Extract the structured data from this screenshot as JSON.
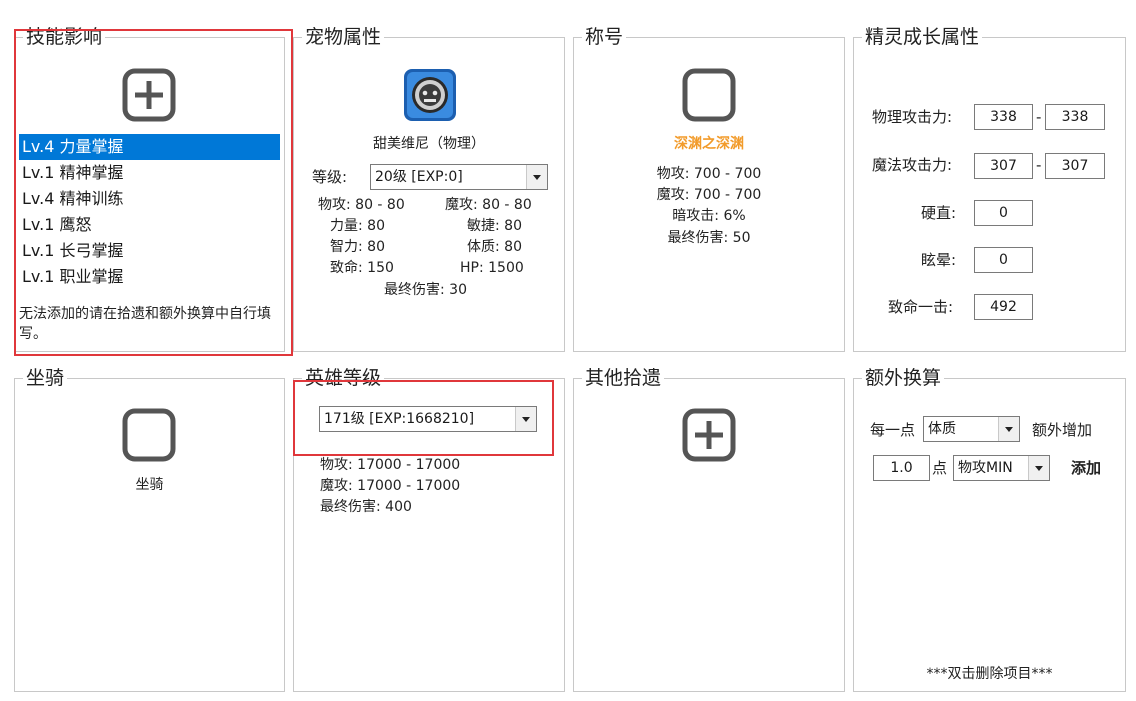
{
  "skills": {
    "title": "技能影响",
    "items": [
      {
        "label": "Lv.4 力量掌握"
      },
      {
        "label": "Lv.1 精神掌握"
      },
      {
        "label": "Lv.4 精神训练"
      },
      {
        "label": "Lv.1 鹰怒"
      },
      {
        "label": "Lv.1 长弓掌握"
      },
      {
        "label": "Lv.1 职业掌握"
      }
    ],
    "note": "无法添加的请在拾遗和额外换算中自行填写。"
  },
  "pet": {
    "title": "宠物属性",
    "name": "甜美维尼（物理）",
    "level_label": "等级:",
    "level_value": "20级 [EXP:0]",
    "stats": {
      "phys_atk": "物攻: 80 - 80",
      "mag_atk": "魔攻: 80 - 80",
      "str": "力量: 80",
      "agi": "敏捷: 80",
      "int": "智力: 80",
      "con": "体质: 80",
      "crit": "致命: 150",
      "hp": "HP: 1500",
      "final": "最终伤害: 30"
    }
  },
  "title_panel": {
    "title": "称号",
    "name": "深渊之深渊",
    "lines": [
      "物攻: 700 - 700",
      "魔攻: 700 - 700",
      "暗攻击: 6%",
      "最终伤害: 50"
    ]
  },
  "spirit": {
    "title": "精灵成长属性",
    "phys_label": "物理攻击力:",
    "phys_min": "338",
    "phys_max": "338",
    "mag_label": "魔法攻击力:",
    "mag_min": "307",
    "mag_max": "307",
    "dash": "-",
    "stiff_label": "硬直:",
    "stiff_value": "0",
    "stun_label": "眩晕:",
    "stun_value": "0",
    "crit_label": "致命一击:",
    "crit_value": "492"
  },
  "mount": {
    "title": "坐骑",
    "name": "坐骑"
  },
  "hero": {
    "title": "英雄等级",
    "level_value": "171级 [EXP:1668210]",
    "lines": [
      "物攻: 17000 - 17000",
      "魔攻: 17000 - 17000",
      "最终伤害: 400"
    ]
  },
  "other": {
    "title": "其他拾遗"
  },
  "extra": {
    "title": "额外换算",
    "per_label": "每一点",
    "per_select": "体质",
    "increase_label": "额外增加",
    "amount": "1.0",
    "point_label": "点",
    "target_select": "物攻MIN",
    "add_label": "添加",
    "footer": "***双击删除项目***"
  },
  "colors": {
    "selection": "#0078d7",
    "highlight_border": "#e0373b",
    "title_orange": "#f29b2a"
  }
}
